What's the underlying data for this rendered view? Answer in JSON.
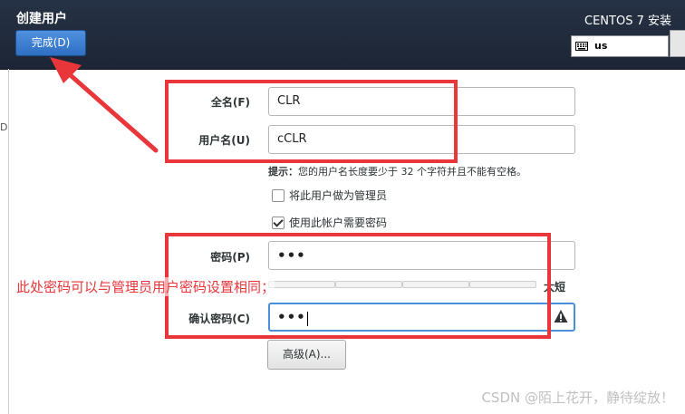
{
  "header": {
    "title": "创建用户",
    "done_label": "完成(D)",
    "product": "CENTOS 7 安装",
    "keyboard_layout": "us"
  },
  "side_mark": "D",
  "form": {
    "fullname_label": "全名(F)",
    "fullname_value": "CLR",
    "username_label": "用户名(U)",
    "username_value": "cCLR",
    "hint_prefix": "提示：",
    "hint_text": "您的用户名长度要少于 32 个字符并且不能有空格。",
    "admin_checkbox_label": "将此用户做为管理员",
    "admin_checked": false,
    "require_password_label": "使用此帐户需要密码",
    "require_password_checked": true,
    "password_label": "密码(P)",
    "password_value": "•••",
    "strength_label": "太短",
    "confirm_label": "确认密码(C)",
    "confirm_value": "•••",
    "advanced_label": "高级(A)..."
  },
  "annotation_text": "此处密码可以与管理员用户密码设置相同；",
  "watermark": "CSDN @陌上花开，静待绽放！",
  "icons": {
    "keyboard": "keyboard-icon",
    "warning": "warning-icon"
  },
  "colors": {
    "header_bg": "#263245",
    "done_button": "#3a7bd5",
    "annotation_red": "#e8363a",
    "focus_border": "#4a90d9"
  }
}
